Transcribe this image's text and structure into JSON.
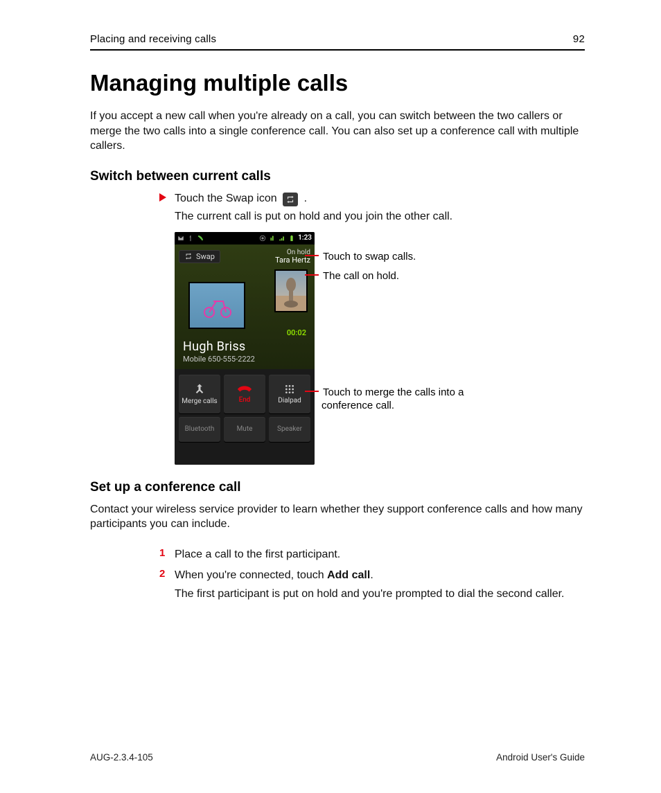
{
  "header": {
    "section": "Placing and receiving calls",
    "page": "92"
  },
  "title": "Managing multiple calls",
  "intro": "If you accept a new call when you're already on a call, you can switch between the two callers or merge the two calls into a single conference call. You can also set up a conference call with multiple callers.",
  "section1": {
    "heading": "Switch between current calls",
    "step_pre": "Touch the Swap icon",
    "step_post": ".",
    "follow": "The current call is put on hold and you join the other call.",
    "anno1": "Touch to swap calls.",
    "anno2": "The call on hold.",
    "anno3": "Touch to merge the calls into a conference call."
  },
  "phone": {
    "status_time": "1:23",
    "swap_label": "Swap",
    "onhold_label": "On hold",
    "onhold_name": "Tara Hertz",
    "timer": "00:02",
    "caller_name": "Hugh Briss",
    "caller_line": "Mobile 650-555-2222",
    "buttons": {
      "merge": "Merge calls",
      "end": "End",
      "dialpad": "Dialpad",
      "bluetooth": "Bluetooth",
      "mute": "Mute",
      "speaker": "Speaker"
    }
  },
  "section2": {
    "heading": "Set up a conference call",
    "intro": "Contact your wireless service provider to learn whether they support conference calls and how many participants you can include.",
    "step1": "Place a call to the first participant.",
    "step2_pre": "When you're connected, touch ",
    "step2_bold": "Add call",
    "step2_post": ".",
    "follow": "The first participant is put on hold and you're prompted to dial the second caller."
  },
  "footer": {
    "left": "AUG-2.3.4-105",
    "right": "Android User's Guide"
  }
}
